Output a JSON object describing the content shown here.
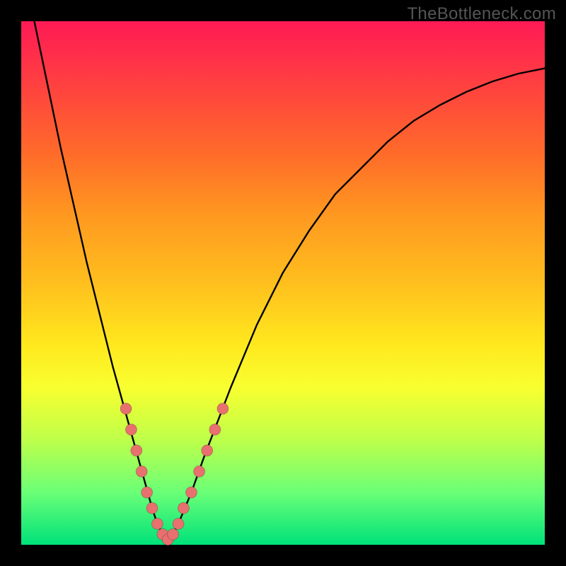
{
  "watermark": "TheBottleneck.com",
  "chart_data": {
    "type": "line",
    "title": "",
    "xlabel": "",
    "ylabel": "",
    "xlim": [
      0,
      100
    ],
    "ylim": [
      0,
      100
    ],
    "grid": false,
    "legend": false,
    "series": [
      {
        "name": "bottleneck-curve",
        "x": [
          0,
          2.5,
          5,
          7.5,
          10,
          12.5,
          15,
          17.5,
          20,
          22.5,
          25,
          26,
          27,
          28,
          29,
          30,
          32.5,
          35,
          40,
          45,
          50,
          55,
          60,
          65,
          70,
          75,
          80,
          85,
          90,
          95,
          100
        ],
        "y": [
          113,
          100,
          88,
          76,
          65,
          54,
          44,
          34,
          25,
          16,
          7,
          4,
          2,
          1,
          2,
          4,
          10,
          17,
          30,
          42,
          52,
          60,
          67,
          72,
          77,
          81,
          84,
          86.5,
          88.5,
          90,
          91
        ]
      }
    ],
    "markers": [
      {
        "name": "highlight-dots",
        "points": [
          {
            "x": 20,
            "y": 26
          },
          {
            "x": 21,
            "y": 22
          },
          {
            "x": 22,
            "y": 18
          },
          {
            "x": 23,
            "y": 14
          },
          {
            "x": 24,
            "y": 10
          },
          {
            "x": 25,
            "y": 7
          },
          {
            "x": 26,
            "y": 4
          },
          {
            "x": 27,
            "y": 2
          },
          {
            "x": 28,
            "y": 1
          },
          {
            "x": 29,
            "y": 2
          },
          {
            "x": 30,
            "y": 4
          },
          {
            "x": 31,
            "y": 7
          },
          {
            "x": 32.5,
            "y": 10
          },
          {
            "x": 34,
            "y": 14
          },
          {
            "x": 35.5,
            "y": 18
          },
          {
            "x": 37,
            "y": 22
          },
          {
            "x": 38.5,
            "y": 26
          }
        ]
      }
    ],
    "colors": {
      "curve": "#000000",
      "dots": "#e8706f",
      "gradient_top": "#ff1a55",
      "gradient_bottom": "#00e27a"
    }
  }
}
